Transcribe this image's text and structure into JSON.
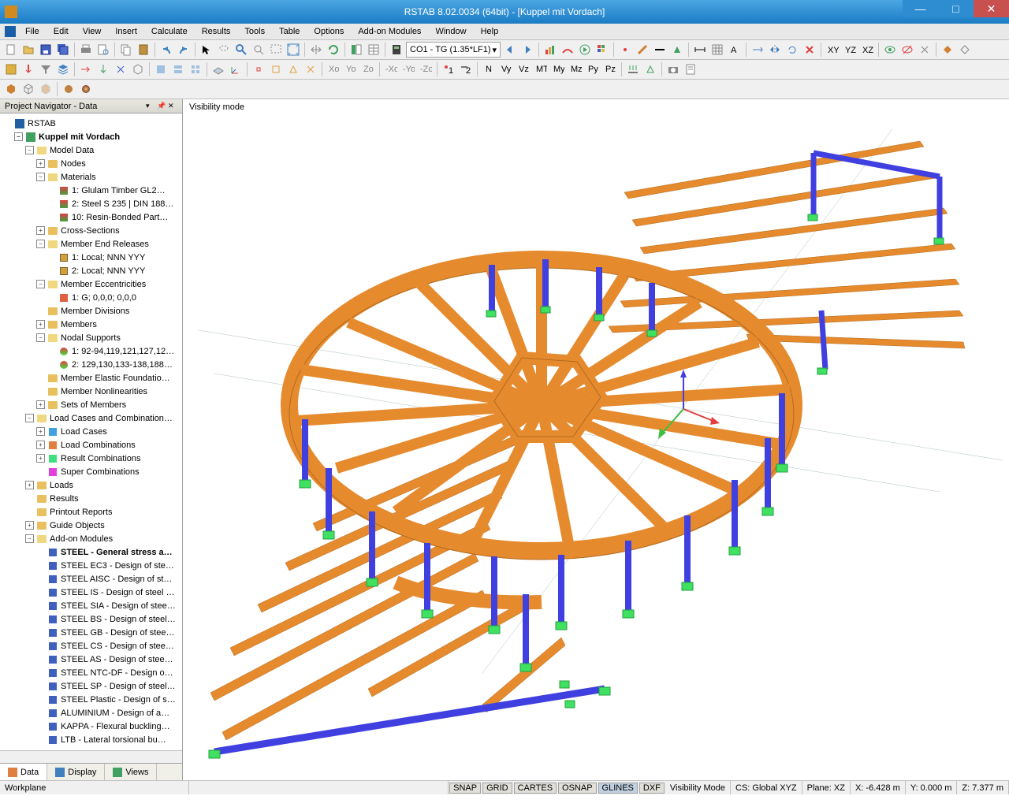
{
  "window": {
    "title": "RSTAB 8.02.0034 (64bit) - [Kuppel mit Vordach]"
  },
  "menu": {
    "items": [
      "File",
      "Edit",
      "View",
      "Insert",
      "Calculate",
      "Results",
      "Tools",
      "Table",
      "Options",
      "Add-on Modules",
      "Window",
      "Help"
    ]
  },
  "toolbar2": {
    "combo": "CO1 - TG  (1.35*LF1)"
  },
  "navigator": {
    "title": "Project Navigator - Data",
    "root": "RSTAB",
    "project": "Kuppel mit Vordach",
    "model_data": "Model Data",
    "nodes": "Nodes",
    "materials": "Materials",
    "mat1": "1: Glulam Timber GL2…",
    "mat2": "2: Steel S 235 | DIN 188…",
    "mat10": "10: Resin-Bonded Part…",
    "cross_sections": "Cross-Sections",
    "member_end": "Member End Releases",
    "mer1": "1: Local; NNN YYY",
    "mer2": "2: Local; NNN YYY",
    "member_ecc": "Member Eccentricities",
    "ecc1": "1: G; 0,0,0; 0,0,0",
    "member_div": "Member Divisions",
    "members": "Members",
    "nodal_supports": "Nodal Supports",
    "ns1": "1: 92-94,119,121,127,12…",
    "ns2": "2: 129,130,133-138,188…",
    "member_elastic": "Member Elastic Foundatio…",
    "member_nonlin": "Member Nonlinearities",
    "sets_members": "Sets of Members",
    "load_cases_comb": "Load Cases and Combination…",
    "load_cases": "Load Cases",
    "load_comb": "Load Combinations",
    "result_comb": "Result Combinations",
    "super_comb": "Super Combinations",
    "loads": "Loads",
    "results": "Results",
    "printout": "Printout Reports",
    "guide_objects": "Guide Objects",
    "addon_modules": "Add-on Modules",
    "steel": "STEEL - General stress a…",
    "steel_ec3": "STEEL EC3 - Design of ste…",
    "steel_aisc": "STEEL AISC - Design of st…",
    "steel_is": "STEEL IS - Design of steel …",
    "steel_sia": "STEEL SIA - Design of stee…",
    "steel_bs": "STEEL BS - Design of steel…",
    "steel_gb": "STEEL GB - Design of stee…",
    "steel_cs": "STEEL CS - Design of stee…",
    "steel_as": "STEEL AS - Design of stee…",
    "steel_ntc": "STEEL NTC-DF - Design o…",
    "steel_sp": "STEEL SP - Design of steel…",
    "steel_plastic": "STEEL Plastic - Design of s…",
    "aluminium": "ALUMINIUM - Design of a…",
    "kappa": "KAPPA - Flexural buckling…",
    "ltb": "LTB - Lateral torsional bu…",
    "tabs": {
      "data": "Data",
      "display": "Display",
      "views": "Views"
    }
  },
  "viewport": {
    "label": "Visibility mode"
  },
  "status": {
    "workplane": "Workplane",
    "snap": "SNAP",
    "grid": "GRID",
    "cartes": "CARTES",
    "osnap": "OSNAP",
    "glines": "GLINES",
    "dxf": "DXF",
    "vismode": "Visibility Mode",
    "cs": "CS: Global XYZ",
    "plane": "Plane: XZ",
    "x": "X:   -6.428 m",
    "y": "Y:   0.000 m",
    "z": "Z:   7.377 m"
  }
}
